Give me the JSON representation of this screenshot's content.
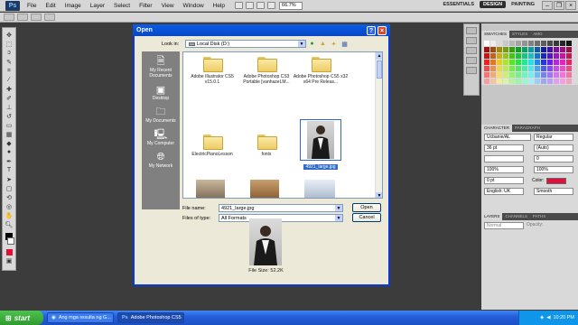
{
  "menubar": {
    "logo": "Ps",
    "items": [
      "File",
      "Edit",
      "Image",
      "Layer",
      "Select",
      "Filter",
      "View",
      "Window",
      "Help"
    ],
    "zoom": "66.7%",
    "workspaces": [
      "ESSENTIALS",
      "DESIGN",
      "PAINTING"
    ],
    "active_workspace": "DESIGN"
  },
  "right_panels": {
    "swatch_tabs": [
      "SWATCHES",
      "STYLES",
      "AMO"
    ],
    "character_tabs": [
      "CHARACTER",
      "PARAGRAPH"
    ],
    "font_family": "Ucbanie/AL",
    "font_style": "Regular",
    "font_size": "36 pt",
    "leading": "(Auto)",
    "tracking": "0",
    "scale_v": "100%",
    "scale_h": "100%",
    "baseline": "0 pt",
    "color_label": "Color:",
    "language": "English: UK",
    "antialias": "Smooth",
    "layers_tabs": [
      "LAYERS",
      "CHANNELS",
      "PATHS"
    ],
    "blend_mode": "Normal",
    "opacity_label": "Opacity:"
  },
  "dialog": {
    "title": "Open",
    "look_in_label": "Look in:",
    "look_in_value": "Local Disk (D:)",
    "places": [
      {
        "icon": "recent-documents-icon",
        "label": "My Recent Documents"
      },
      {
        "icon": "desktop-icon",
        "label": "Desktop"
      },
      {
        "icon": "my-documents-icon",
        "label": "My Documents"
      },
      {
        "icon": "my-computer-icon",
        "label": "My Computer"
      },
      {
        "icon": "my-network-icon",
        "label": "My Network"
      }
    ],
    "files": [
      {
        "name": "Adobe Illustrator CS5 v15.0.1",
        "kind": "folder"
      },
      {
        "name": "Adobe Photoshop CS3 Portable [vanhazeLM...",
        "kind": "folder"
      },
      {
        "name": "Adobe Photoshop CS5 x32 x64 Pre Releas...",
        "kind": "folder"
      },
      {
        "name": "ElectricPianoLesson",
        "kind": "folder"
      },
      {
        "name": "fonts",
        "kind": "folder"
      },
      {
        "name": "4921_large.jpg",
        "kind": "image",
        "selected": true
      }
    ],
    "file_name_label": "File name:",
    "file_name_value": "4921_large.jpg",
    "files_of_type_label": "Files of type:",
    "files_of_type_value": "All Formats",
    "open_button": "Open",
    "cancel_button": "Cancel",
    "file_size": "File Size: 52.2K"
  },
  "taskbar": {
    "start": "start",
    "tasks": [
      {
        "label": "Ang mga resulta ng G...",
        "active": false
      },
      {
        "label": "Adobe Photoshop CS5",
        "active": true
      }
    ],
    "clock": "10:20 PM"
  }
}
